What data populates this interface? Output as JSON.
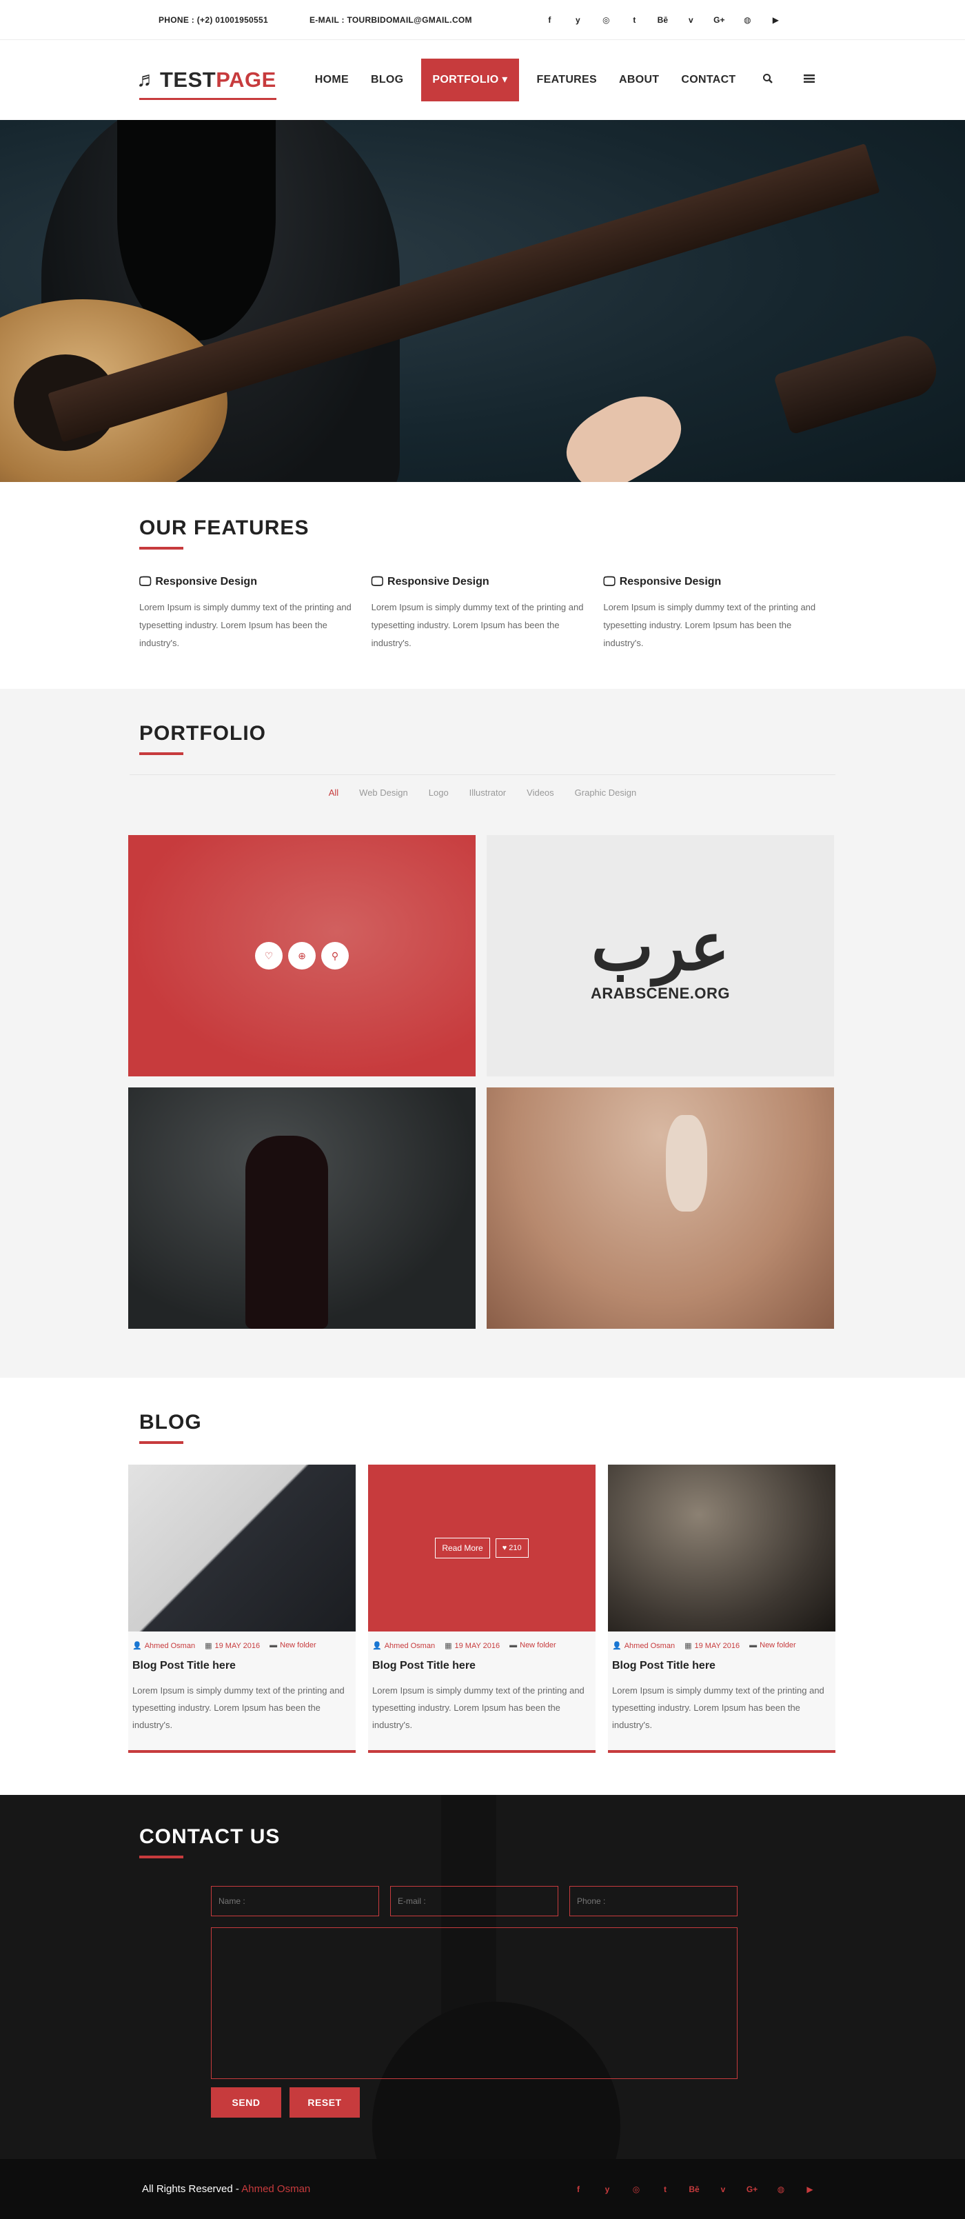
{
  "topbar": {
    "phone": "PHONE : (+2) 01001950551",
    "email": "E-MAIL : TOURBIDOMAIL@GMAIL.COM",
    "social": [
      "f",
      "y",
      "◎",
      "t",
      "Bē",
      "v",
      "G+",
      "◍",
      "▶"
    ]
  },
  "logo": {
    "part1": "TEST",
    "part2": "PAGE",
    "icon": "music-note-icon"
  },
  "nav": {
    "items": [
      "HOME",
      "BLOG",
      "PORTFOLIO ▾",
      "FEATURES",
      "ABOUT",
      "CONTACT"
    ],
    "active": "PORTFOLIO ▾",
    "search_icon": "search-icon",
    "menu_icon": "menu-icon"
  },
  "features": {
    "title": "OUR FEATURES",
    "items": [
      {
        "icon": "monitor-icon",
        "title": "Responsive Design",
        "text": "Lorem Ipsum is simply dummy text of the printing and typesetting industry. Lorem Ipsum has been the industry's."
      },
      {
        "icon": "monitor-icon",
        "title": "Responsive Design",
        "text": "Lorem Ipsum is simply dummy text of the printing and typesetting industry. Lorem Ipsum has been the industry's."
      },
      {
        "icon": "monitor-icon",
        "title": "Responsive Design",
        "text": "Lorem Ipsum is simply dummy text of the printing and typesetting industry. Lorem Ipsum has been the industry's."
      }
    ]
  },
  "portfolio": {
    "title": "PORTFOLIO",
    "filters": [
      "All",
      "Web Design",
      "Logo",
      "Illustrator",
      "Videos",
      "Graphic Design"
    ],
    "active_filter": "All",
    "logo_caption": "ARABSCENE.ORG"
  },
  "blog": {
    "title": "BLOG",
    "read_more": "Read More",
    "likes": "♥ 210",
    "posts": [
      {
        "author": "Ahmed Osman",
        "date": "19 MAY 2016",
        "folder": "New folder",
        "title": "Blog Post Title here",
        "text": "Lorem Ipsum is simply dummy text of the printing and typesetting industry. Lorem Ipsum has been the industry's."
      },
      {
        "author": "Ahmed Osman",
        "date": "19 MAY 2016",
        "folder": "New folder",
        "title": "Blog Post Title here",
        "text": "Lorem Ipsum is simply dummy text of the printing and typesetting industry. Lorem Ipsum has been the industry's."
      },
      {
        "author": "Ahmed Osman",
        "date": "19 MAY 2016",
        "folder": "New folder",
        "title": "Blog Post Title here",
        "text": "Lorem Ipsum is simply dummy text of the printing and typesetting industry. Lorem Ipsum has been the industry's."
      }
    ]
  },
  "contact": {
    "title": "CONTACT US",
    "name_placeholder": "Name :",
    "email_placeholder": "E-mail :",
    "phone_placeholder": "Phone :",
    "send": "SEND",
    "reset": "RESET"
  },
  "footer": {
    "rights": "All Rights Reserved - ",
    "author": "Ahmed Osman",
    "social": [
      "f",
      "y",
      "◎",
      "t",
      "Bē",
      "v",
      "G+",
      "◍",
      "▶"
    ]
  },
  "colors": {
    "accent": "#c73b3d",
    "dark": "#171717",
    "footer": "#0d0d0d"
  }
}
